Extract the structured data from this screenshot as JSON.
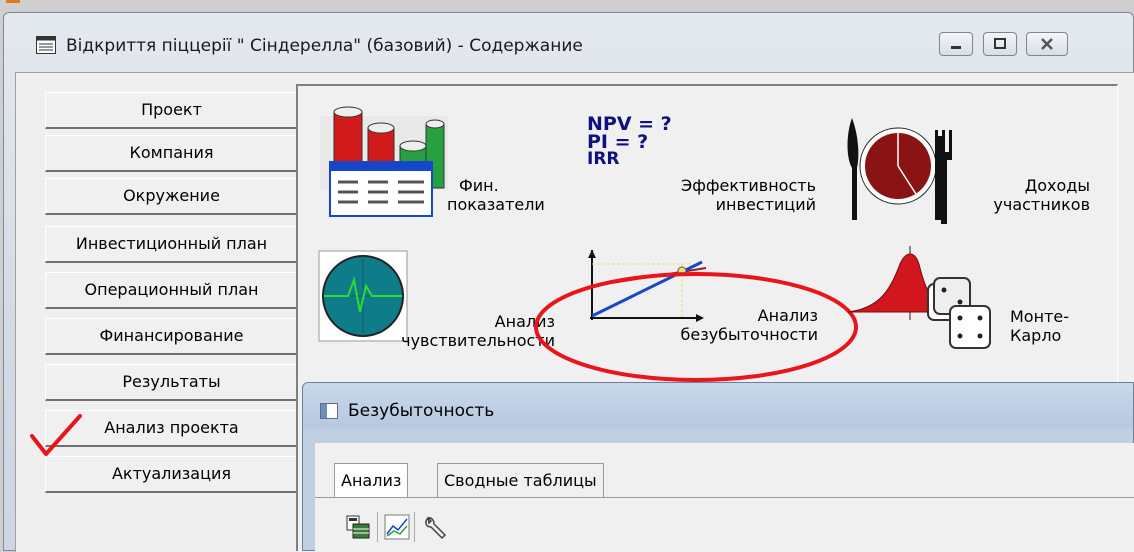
{
  "window": {
    "title": "Відкриття піццерії \" Сіндерелла\" (базовий) - Содержание"
  },
  "nav": {
    "items": [
      {
        "label": "Проект"
      },
      {
        "label": "Компания"
      },
      {
        "label": "Окружение"
      },
      {
        "label": "Инвестиционный план"
      },
      {
        "label": "Операционный план"
      },
      {
        "label": "Финансирование"
      },
      {
        "label": "Результаты"
      },
      {
        "label": "Анализ проекта"
      },
      {
        "label": "Актуализация"
      }
    ]
  },
  "modules": {
    "fin": {
      "line1": "Фин.",
      "line2": "показатели"
    },
    "eff": {
      "formula1": "NPV = ?",
      "formula2": "PI = ?",
      "formula3": "IRR",
      "line1": "Эффективность",
      "line2": "инвестиций"
    },
    "income": {
      "line1": "Доходы",
      "line2": "участников"
    },
    "sens": {
      "line1": "Анализ",
      "line2": "чувствительности"
    },
    "breakeven": {
      "line1": "Анализ",
      "line2": "безубыточности"
    },
    "montecarlo": {
      "line1": "Монте-",
      "line2": "Карло"
    }
  },
  "subwindow": {
    "title": "Безубыточность",
    "tabs": [
      {
        "label": "Анализ"
      },
      {
        "label": "Сводные таблицы"
      }
    ]
  },
  "colors": {
    "annotation": "#e8151b",
    "accent_red": "#d2161e",
    "accent_blue": "#1747c9"
  }
}
